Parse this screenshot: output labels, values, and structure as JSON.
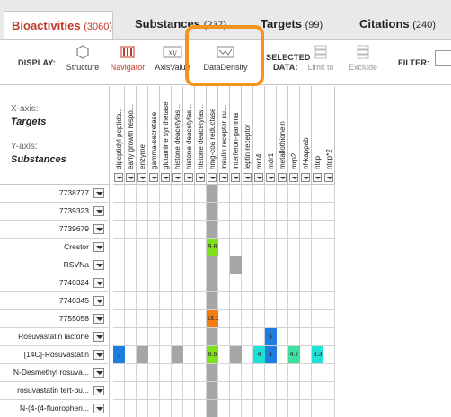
{
  "tabs": [
    {
      "label": "Bioactivities",
      "count": "(3060)",
      "active": true
    },
    {
      "label": "Substances",
      "count": "(237)",
      "active": false
    },
    {
      "label": "Targets",
      "count": "(99)",
      "active": false
    },
    {
      "label": "Citations",
      "count": "(240)",
      "active": false
    }
  ],
  "toolbar": {
    "display_label": "DISPLAY:",
    "buttons": [
      {
        "label": "Structure",
        "icon": "hexagon-icon"
      },
      {
        "label": "Navigator",
        "icon": "bars-icon",
        "selected": true
      },
      {
        "label": "AxisValue",
        "icon": "xy-icon"
      },
      {
        "label": "DataDensity",
        "icon": "density-icon",
        "highlighted": true
      }
    ],
    "selected_data_label": "SELECTED\nDATA:",
    "selected_buttons": [
      {
        "label": "Limit to",
        "icon": "grid-small-icon"
      },
      {
        "label": "Exclude",
        "icon": "grid-small-icon"
      }
    ],
    "filter_label": "FILTER:"
  },
  "axis": {
    "x_label": "X-axis:",
    "x_value": "Targets",
    "y_label": "Y-axis:",
    "y_value": "Substances"
  },
  "columns": [
    "dipeptidyl peptida...",
    "early growth respo...",
    "enzyme",
    "gamma-secretase",
    "glutamine synthetase",
    "histone deacetylas...",
    "histone deacetylas...",
    "histone deacetylas...",
    "hmg-coa reductase",
    "insulin receptor su...",
    "interferon-gamma",
    "leptin receptor",
    "mct4",
    "mdr1",
    "metallothionein",
    "mrp2",
    "nf-kappab",
    "ntcp",
    "ntcp*2"
  ],
  "rows": [
    "7738777",
    "7739323",
    "7739679",
    "Crestor",
    "RSVNa",
    "7740324",
    "7740345",
    "7755058",
    "Rosuvastatin lactone",
    "[14C]-Rosuvastatin",
    "N-Desmethyl rosuva...",
    "rosuvastatin tert-bu...",
    "N-(4-(4-fluorophen...",
    ""
  ],
  "cells": [
    {
      "row": 3,
      "col": 8,
      "value": "9.8",
      "color": "#7fe01c"
    },
    {
      "row": 4,
      "col": 10,
      "value": "",
      "color": "#a6a6a6"
    },
    {
      "row": 7,
      "col": 8,
      "value": "13.1",
      "color": "#f47d14"
    },
    {
      "row": 8,
      "col": 13,
      "value": "1",
      "color": "#1f7de0"
    },
    {
      "row": 9,
      "col": 0,
      "value": "1",
      "color": "#1f7de0"
    },
    {
      "row": 9,
      "col": 2,
      "value": "",
      "color": "#a6a6a6"
    },
    {
      "row": 9,
      "col": 5,
      "value": "",
      "color": "#a6a6a6"
    },
    {
      "row": 9,
      "col": 8,
      "value": "8.6",
      "color": "#7fe01c"
    },
    {
      "row": 9,
      "col": 10,
      "value": "",
      "color": "#a6a6a6"
    },
    {
      "row": 9,
      "col": 12,
      "value": "4",
      "color": "#1ee0d6"
    },
    {
      "row": 9,
      "col": 13,
      "value": "1",
      "color": "#1f7de0"
    },
    {
      "row": 9,
      "col": 15,
      "value": "4.7",
      "color": "#3ee0a0"
    },
    {
      "row": 9,
      "col": 17,
      "value": "3.3",
      "color": "#1ee0d6"
    }
  ],
  "column_fill": {
    "col": 8,
    "color": "#a6a6a6"
  },
  "colors": {
    "accent_red": "#c0392b",
    "highlight_orange": "#f4941f"
  }
}
